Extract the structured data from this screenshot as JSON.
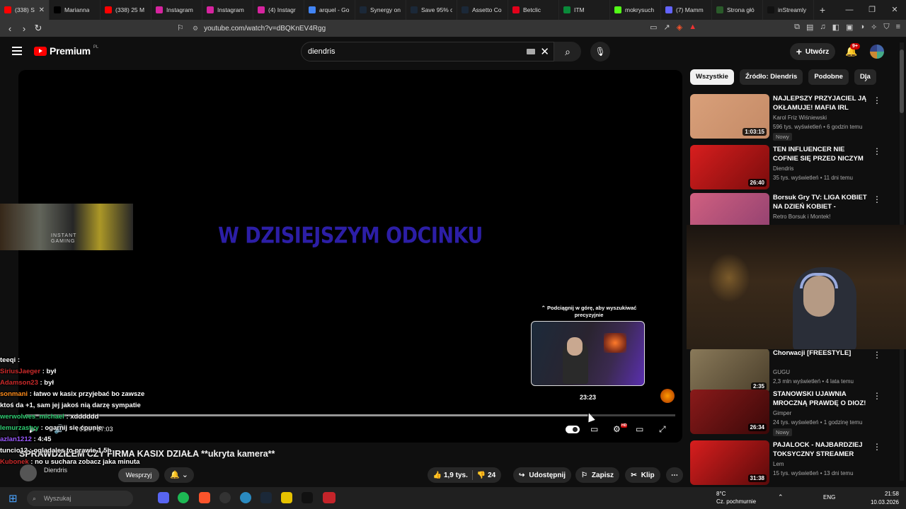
{
  "browser": {
    "tabs": [
      {
        "label": "(338) S",
        "fav": "#ff0000",
        "active": true
      },
      {
        "label": "Marianna",
        "fav": "#000000"
      },
      {
        "label": "(338) 25 M",
        "fav": "#ff0000"
      },
      {
        "label": "Instagram",
        "fav": "#d6249f"
      },
      {
        "label": "Instagram",
        "fav": "#d6249f"
      },
      {
        "label": "(4) Instagr",
        "fav": "#d6249f"
      },
      {
        "label": "arquel - Go",
        "fav": "#4285f4"
      },
      {
        "label": "Synergy on",
        "fav": "#1b2838"
      },
      {
        "label": "Save 95% o",
        "fav": "#1b2838"
      },
      {
        "label": "Assetto Co",
        "fav": "#1b2838"
      },
      {
        "label": "Betclic",
        "fav": "#e2001a"
      },
      {
        "label": "ITM",
        "fav": "#0a8a3a"
      },
      {
        "label": "mokrysuch",
        "fav": "#53fc18"
      },
      {
        "label": "(7) Mamm",
        "fav": "#6364ff"
      },
      {
        "label": "Strona głó",
        "fav": "#2a5a2a"
      },
      {
        "label": "inStreamly",
        "fav": "#111111"
      }
    ],
    "url": "youtube.com/watch?v=dBQKnEV4Rgg"
  },
  "header": {
    "logo_text": "Premium",
    "logo_region": "PL",
    "search_value": "diendris",
    "create_label": "Utwórz",
    "notif_count": "9+"
  },
  "player": {
    "overlay_text": "W DZISIEJSZYM ODCINKU",
    "ad_text_1": "INSTANT",
    "ad_text_2": "GAMING",
    "seek_hint": "⌃ Podciągnij w górę, aby wyszukiwać precyzyjnie",
    "preview_time": "23:23",
    "time_display": "0:00 / 27:03",
    "progress_fraction": 0.865
  },
  "chat": [
    {
      "user": "teeqi",
      "text": ":",
      "color": "#ffffff"
    },
    {
      "user": "SiriusJaeger",
      "text": ": był",
      "color": "#cc2a2a"
    },
    {
      "user": "Adamson23",
      "text": ": był",
      "color": "#cc2a2a"
    },
    {
      "user": "sonmani",
      "text": ": łatwo w kasix przyjebać bo zawsze ktoś da +1, sam jej jakoś nią darzę sympatie",
      "color": "#ff8c1a"
    },
    {
      "user": "werwolwes_michael",
      "text": ": xdddddd",
      "color": "#2ecc71"
    },
    {
      "user": "lemurzastyy",
      "text": ": ogarnij się ćpunie",
      "color": "#2ecc71"
    },
    {
      "user": "azlan1212",
      "text": ": 4:45",
      "color": "#9b59ff"
    },
    {
      "user": "tuncio12",
      "text": ": ogladales to prawie 1.5h",
      "color": "#ffffff"
    },
    {
      "user": "Kubonek",
      "text": ": no u suchara zobacz jaka minuta",
      "color": "#cc2a2a"
    }
  ],
  "video": {
    "title": "SPRAWDZIŁEM CZY FIRMA KASIX DZIAŁA **ukryta kamera**",
    "channel": "Diendris",
    "support_label": "Wesprzyj",
    "likes": "1,9 tys.",
    "dislikes": "24",
    "share_label": "Udostępnij",
    "save_label": "Zapisz",
    "clip_label": "Klip"
  },
  "chips": [
    "Wszystkie",
    "Źródło: Diendris",
    "Podobne",
    "Dla"
  ],
  "recommendations": [
    {
      "title": "NAJLEPSZY PRZYJACIEL JĄ OKŁAMUJE! MAFIA IRL SEZO...",
      "channel": "Karol Friz Wiśniewski",
      "meta": "596 tys. wyświetleń • 6 godzin temu",
      "badge": "Nowy",
      "duration": "1:03:15",
      "c1": "#d9a07a",
      "c2": "#c48a66"
    },
    {
      "title": "TEN INFLUENCER NIE COFNIE SIĘ PRZED NICZYM",
      "channel": "Diendris",
      "meta": "35 tys. wyświetleń • 11 dni temu",
      "badge": "",
      "duration": "26:40",
      "c1": "#d81e1e",
      "c2": "#7a0c0c"
    },
    {
      "title": "Borsuk Gry TV: LIGA KOBIET NA DZIEŃ KOBIET - Dziewczyny ...",
      "channel": "Retro Borsuk i Montek!",
      "meta": "",
      "badge": "",
      "duration": "",
      "c1": "#d06080",
      "c2": "#904070"
    },
    {
      "title": "Chorwacji [FREESTYLE]",
      "channel": "GUGU",
      "meta": "2,3 mln wyświetleń • 4 lata temu",
      "badge": "",
      "duration": "2:35",
      "c1": "#8a7a5a",
      "c2": "#4a3e2a"
    },
    {
      "title": "STANOWSKI UJAWNIA MROCZNĄ PRAWDĘ O DIOZ! ...",
      "channel": "Gimper",
      "meta": "24 tys. wyświetleń • 1 godzinę temu",
      "badge": "Nowy",
      "duration": "26:34",
      "c1": "#8a1a1a",
      "c2": "#3a0808"
    },
    {
      "title": "PAJALOCK - NAJBARDZIEJ TOKSYCZNY STREAMER",
      "channel": "Lem",
      "meta": "15 tys. wyświetleń • 13 dni temu",
      "badge": "",
      "duration": "31:38",
      "c1": "#d81e1e",
      "c2": "#5a0a0a"
    }
  ],
  "taskbar": {
    "search_placeholder": "Wyszukaj",
    "temp": "8°C",
    "weather": "Cz. pochmurnie",
    "lang": "ENG",
    "clock": "21:58",
    "date": "10.03.2026"
  }
}
